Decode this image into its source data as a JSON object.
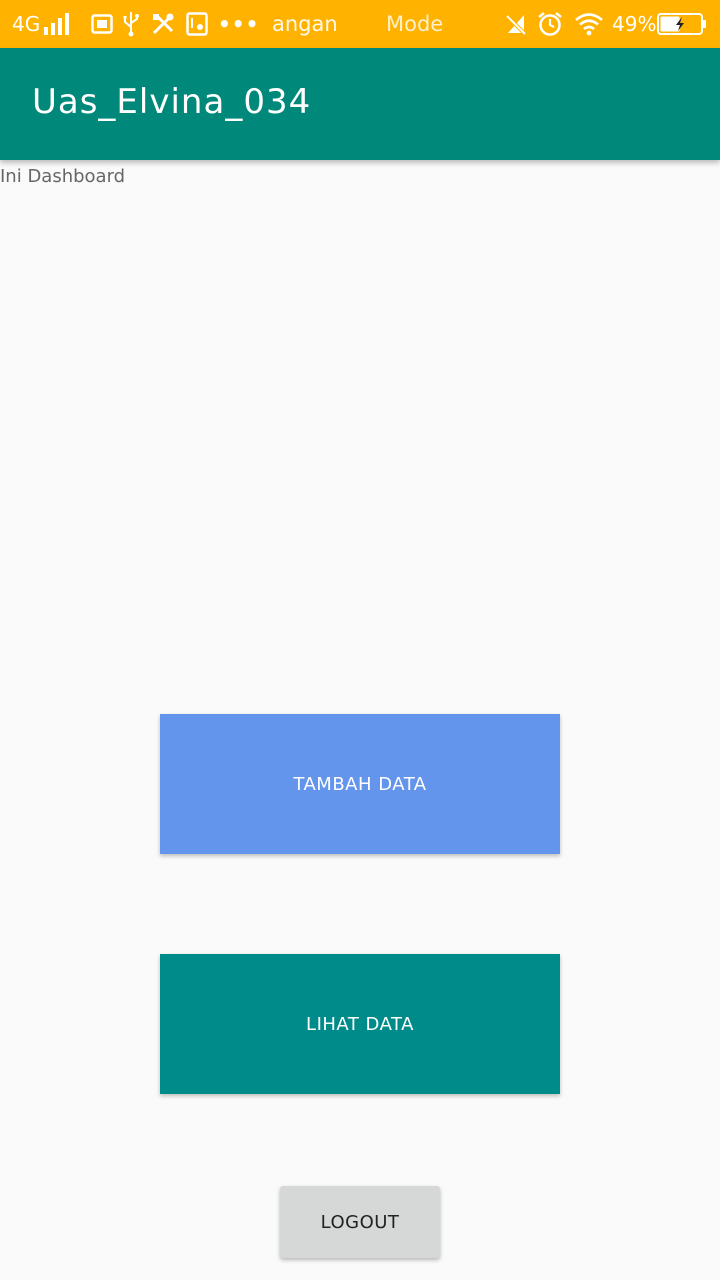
{
  "status_bar": {
    "network_type": "4G",
    "ticker_left": "angan",
    "ticker_right": "Mode",
    "battery_percent": "49%",
    "battery_level": 0.49,
    "charging": true,
    "icons": [
      "signal-icon",
      "notification-icon",
      "usb-icon",
      "tools-icon",
      "app-icon",
      "more-icon",
      "mute-icon",
      "alarm-icon",
      "wifi-icon",
      "battery-icon"
    ],
    "background": "#ffb300"
  },
  "app_bar": {
    "title": "Uas_Elvina_034",
    "background": "#00897b"
  },
  "main": {
    "dashboard_text": "Ini Dashboard",
    "buttons": {
      "tambah_label": "TAMBAH DATA",
      "lihat_label": "LIHAT DATA",
      "logout_label": "LOGOUT"
    },
    "colors": {
      "tambah": "#6495ed",
      "lihat": "#008b8b",
      "logout": "#d6d7d7"
    }
  }
}
